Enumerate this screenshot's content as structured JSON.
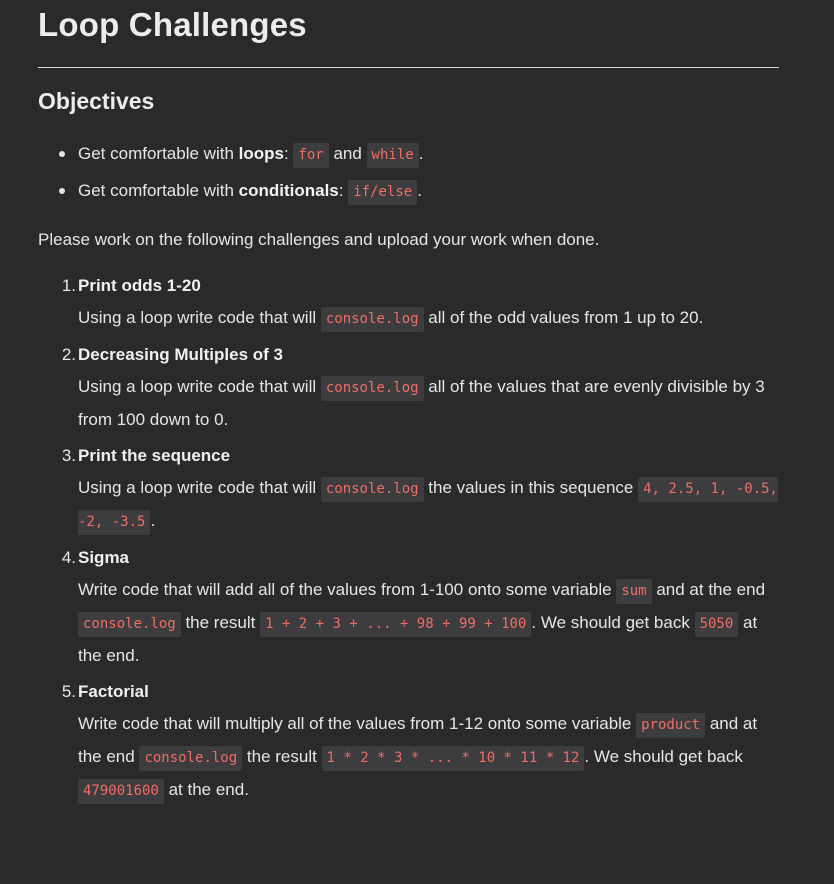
{
  "title": "Loop Challenges",
  "objectives": {
    "heading": "Objectives",
    "items": [
      {
        "prefix": "Get comfortable with ",
        "bold": "loops",
        "sep": ": ",
        "code1": "for",
        "mid": " and ",
        "code2": "while",
        "end": "."
      },
      {
        "prefix": "Get comfortable with ",
        "bold": "conditionals",
        "sep": ": ",
        "code1": "if/else",
        "end": "."
      }
    ]
  },
  "intro": "Please work on the following challenges and upload your work when done.",
  "challenges": [
    {
      "num": "1.",
      "title": "Print odds 1-20",
      "parts": [
        "Using a loop write code that will ",
        "console.log",
        " all of the odd values from 1 up to 20."
      ]
    },
    {
      "num": "2.",
      "title": "Decreasing Multiples of 3",
      "parts": [
        "Using a loop write code that will ",
        "console.log",
        " all of the values that are evenly divisible by 3 from 100 down to 0."
      ]
    },
    {
      "num": "3.",
      "title": "Print the sequence",
      "parts": [
        "Using a loop write code that will ",
        "console.log",
        " the values in this sequence ",
        "4, 2.5, 1, -0.5, -2, -3.5",
        "."
      ]
    },
    {
      "num": "4.",
      "title": "Sigma",
      "parts": [
        "Write code that will add all of the values from 1-100 onto some variable ",
        "sum",
        " and at the end ",
        "console.log",
        " the result ",
        "1 + 2 + 3 + ... + 98 + 99 + 100",
        ". We should get back ",
        "5050",
        " at the end."
      ]
    },
    {
      "num": "5.",
      "title": "Factorial",
      "parts": [
        "Write code that will multiply all of the values from 1-12 onto some variable ",
        "product",
        " and at the end ",
        "console.log",
        " the result ",
        "1 * 2 * 3 * ... * 10 * 11 * 12",
        ". We should get back ",
        "479001600",
        " at the end."
      ]
    }
  ]
}
